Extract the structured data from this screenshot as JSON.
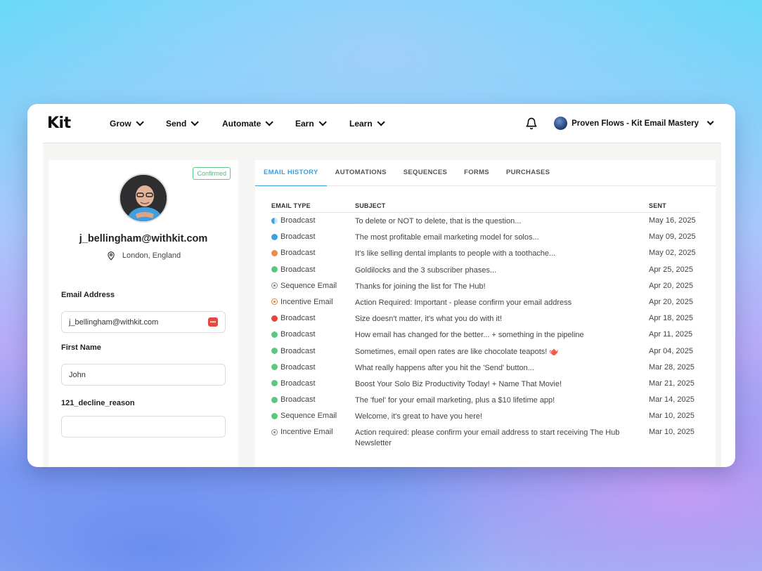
{
  "app": {
    "logo": "Kit",
    "nav": [
      {
        "label": "Grow"
      },
      {
        "label": "Send"
      },
      {
        "label": "Automate"
      },
      {
        "label": "Earn"
      },
      {
        "label": "Learn"
      }
    ],
    "account_name": "Proven Flows - Kit Email Mastery"
  },
  "profile": {
    "status_badge": "Confirmed",
    "email": "j_bellingham@withkit.com",
    "location": "London, England",
    "fields": {
      "email_label": "Email Address",
      "email_value": "j_bellingham@withkit.com",
      "first_name_label": "First Name",
      "first_name_value": "John",
      "decline_label": "121_decline_reason",
      "decline_value": ""
    }
  },
  "tabs": [
    "EMAIL HISTORY",
    "AUTOMATIONS",
    "SEQUENCES",
    "FORMS",
    "PURCHASES"
  ],
  "active_tab": "EMAIL HISTORY",
  "table": {
    "headers": {
      "type": "EMAIL TYPE",
      "subject": "SUBJECT",
      "sent": "SENT"
    },
    "rows": [
      {
        "type": "Broadcast",
        "status": "half-blue",
        "subject": "To delete or NOT to delete, that is the question...",
        "sent": "May 16, 2025"
      },
      {
        "type": "Broadcast",
        "status": "blue",
        "subject": "The most profitable email marketing model for solos...",
        "sent": "May 09, 2025"
      },
      {
        "type": "Broadcast",
        "status": "orange",
        "subject": "It's like selling dental implants to people with a toothache...",
        "sent": "May 02, 2025"
      },
      {
        "type": "Broadcast",
        "status": "green",
        "subject": "Goldilocks and the 3 subscriber phases...",
        "sent": "Apr 25, 2025"
      },
      {
        "type": "Sequence Email",
        "status": "ring-gray",
        "subject": "Thanks for joining the list for The Hub!",
        "sent": "Apr 20, 2025"
      },
      {
        "type": "Incentive Email",
        "status": "ring-orange",
        "subject": "Action Required: Important - please confirm your email address",
        "sent": "Apr 20, 2025"
      },
      {
        "type": "Broadcast",
        "status": "red",
        "subject": "Size doesn't matter, it's what you do with it!",
        "sent": "Apr 18, 2025"
      },
      {
        "type": "Broadcast",
        "status": "green",
        "subject": "How email has changed for the better... + something in the pipeline",
        "sent": "Apr 11, 2025"
      },
      {
        "type": "Broadcast",
        "status": "green",
        "subject": "Sometimes, email open rates are like chocolate teapots! 🫖",
        "sent": "Apr 04, 2025"
      },
      {
        "type": "Broadcast",
        "status": "green",
        "subject": "What really happens after you hit the 'Send' button...",
        "sent": "Mar 28, 2025"
      },
      {
        "type": "Broadcast",
        "status": "green",
        "subject": "Boost Your Solo Biz Productivity Today! + Name That Movie!",
        "sent": "Mar 21, 2025"
      },
      {
        "type": "Broadcast",
        "status": "green",
        "subject": "The 'fuel' for your email marketing, plus a $10 lifetime app!",
        "sent": "Mar 14, 2025"
      },
      {
        "type": "Sequence Email",
        "status": "green",
        "subject": "Welcome, it's great to have you here!",
        "sent": "Mar 10, 2025"
      },
      {
        "type": "Incentive Email",
        "status": "ring-gray",
        "subject": "Action required: please confirm your email address to start receiving The Hub Newsletter",
        "sent": "Mar 10, 2025"
      }
    ]
  },
  "colors": {
    "accent": "#3fa0d8",
    "green": "#5cc87d",
    "blue": "#3fa0e0",
    "orange": "#ea8a4e",
    "red": "#e2473e"
  }
}
